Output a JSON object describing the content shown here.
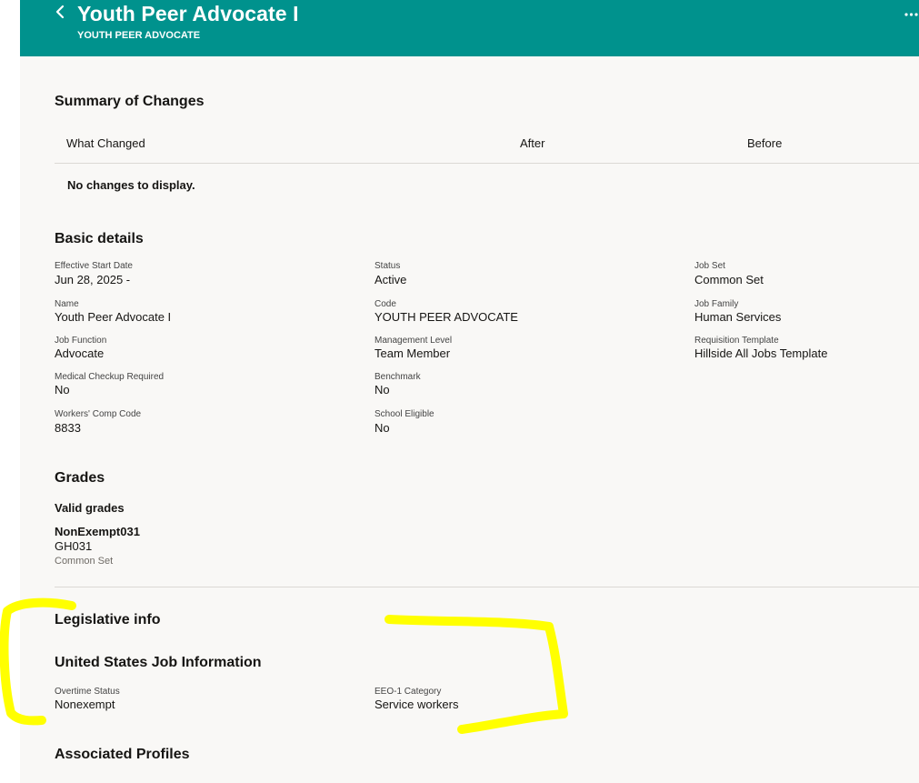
{
  "header": {
    "title": "Youth Peer Advocate I",
    "subtitle": "YOUTH PEER ADVOCATE",
    "back_icon": "chevron-left-icon",
    "more_icon": "more-horizontal-icon",
    "background_color": "#00928d"
  },
  "summary": {
    "title": "Summary of Changes",
    "columns": [
      "What Changed",
      "After",
      "Before"
    ],
    "empty_message": "No changes to display."
  },
  "basic_details": {
    "title": "Basic details",
    "fields": {
      "effective_start_date": {
        "label": "Effective Start Date",
        "value": "Jun 28, 2025 -"
      },
      "status": {
        "label": "Status",
        "value": "Active"
      },
      "job_set": {
        "label": "Job Set",
        "value": "Common Set"
      },
      "name": {
        "label": "Name",
        "value": "Youth Peer Advocate I"
      },
      "code": {
        "label": "Code",
        "value": "YOUTH PEER ADVOCATE"
      },
      "job_family": {
        "label": "Job Family",
        "value": "Human Services"
      },
      "job_function": {
        "label": "Job Function",
        "value": "Advocate"
      },
      "management_level": {
        "label": "Management Level",
        "value": "Team Member"
      },
      "requisition_template": {
        "label": "Requisition Template",
        "value": "Hillside All Jobs Template"
      },
      "medical_checkup": {
        "label": "Medical Checkup Required",
        "value": "No"
      },
      "benchmark": {
        "label": "Benchmark",
        "value": "No"
      },
      "workers_comp": {
        "label": "Workers' Comp Code",
        "value": "8833"
      },
      "school_eligible": {
        "label": "School Eligible",
        "value": "No"
      }
    }
  },
  "grades": {
    "title": "Grades",
    "valid_grades_label": "Valid grades",
    "items": [
      {
        "name": "NonExempt031",
        "code": "GH031",
        "set": "Common Set"
      }
    ]
  },
  "legislative": {
    "title": "Legislative info",
    "subtitle": "United States Job Information",
    "fields": {
      "overtime_status": {
        "label": "Overtime Status",
        "value": "Nonexempt"
      },
      "eeo1_category": {
        "label": "EEO-1 Category",
        "value": "Service workers"
      }
    }
  },
  "associated_profiles": {
    "title": "Associated Profiles"
  },
  "annotation": {
    "highlight_color": "#ffff00"
  }
}
